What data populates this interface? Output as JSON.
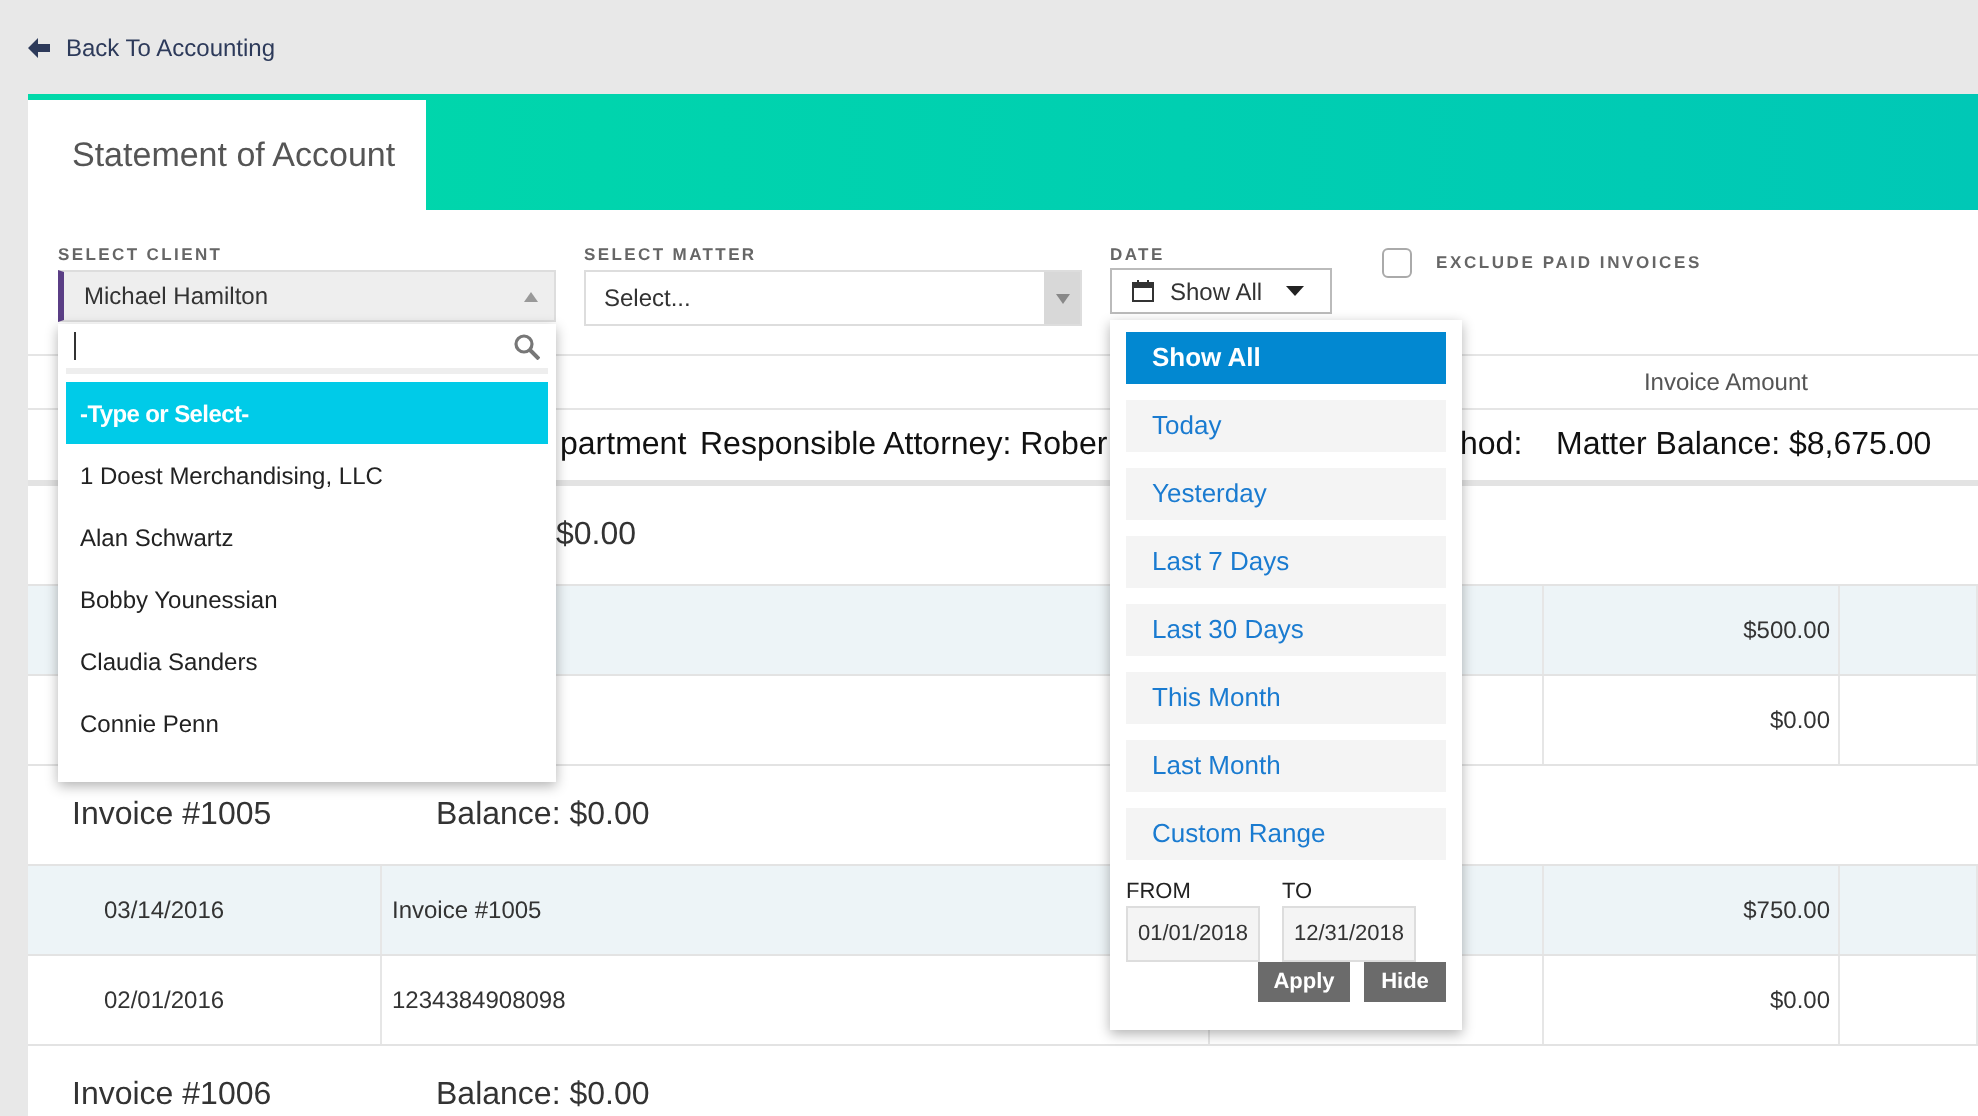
{
  "back_link": {
    "label": "Back To Accounting"
  },
  "tabs": [
    {
      "label": "Statement of Account",
      "selected": true
    }
  ],
  "filters": {
    "client": {
      "label": "SELECT CLIENT",
      "value": "Michael Hamilton",
      "expanded": true
    },
    "matter": {
      "label": "SELECT MATTER",
      "placeholder": "Select..."
    },
    "date": {
      "label": "DATE",
      "value": "Show All",
      "expanded": true
    },
    "exclude_paid": {
      "label": "EXCLUDE PAID INVOICES",
      "checked": false
    }
  },
  "table": {
    "header": "Invoice Amount",
    "matter_row": [
      "partment",
      "Responsible Attorney: Rober",
      "hod:",
      "Matter Balance: $8,675.00"
    ],
    "rows": [
      {
        "kind": "group",
        "balance": "$0.00"
      },
      {
        "kind": "entry",
        "amount": "$500.00"
      },
      {
        "kind": "entry",
        "amount": "$0.00"
      },
      {
        "kind": "group",
        "title": "Invoice #1005",
        "balance": "Balance: $0.00"
      },
      {
        "kind": "entry",
        "date": "03/14/2016",
        "description": "Invoice #1005",
        "amount": "$750.00"
      },
      {
        "kind": "entry",
        "date": "02/01/2016",
        "description": "1234384908098",
        "amount": "$0.00"
      },
      {
        "kind": "group",
        "title": "Invoice #1006",
        "balance": "Balance: $0.00"
      }
    ]
  },
  "client_dropdown": {
    "options": [
      {
        "label": "-Type or Select-",
        "selected": true
      },
      {
        "label": "1 Doest Merchandising, LLC",
        "selected": false
      },
      {
        "label": "Alan Schwartz",
        "selected": false
      },
      {
        "label": "Bobby Younessian",
        "selected": false
      },
      {
        "label": "Claudia Sanders",
        "selected": false
      },
      {
        "label": "Connie Penn",
        "selected": false
      }
    ]
  },
  "date_dropdown": {
    "options": [
      {
        "label": "Show All",
        "selected": true
      },
      {
        "label": "Today",
        "selected": false
      },
      {
        "label": "Yesterday",
        "selected": false
      },
      {
        "label": "Last 7 Days",
        "selected": false
      },
      {
        "label": "Last 30 Days",
        "selected": false
      },
      {
        "label": "This Month",
        "selected": false
      },
      {
        "label": "Last Month",
        "selected": false
      },
      {
        "label": "Custom Range",
        "selected": false
      }
    ],
    "from": {
      "label": "FROM",
      "value": "01/01/2018"
    },
    "to": {
      "label": "TO",
      "value": "12/31/2018"
    },
    "buttons": [
      "Apply",
      "Hide"
    ]
  }
}
